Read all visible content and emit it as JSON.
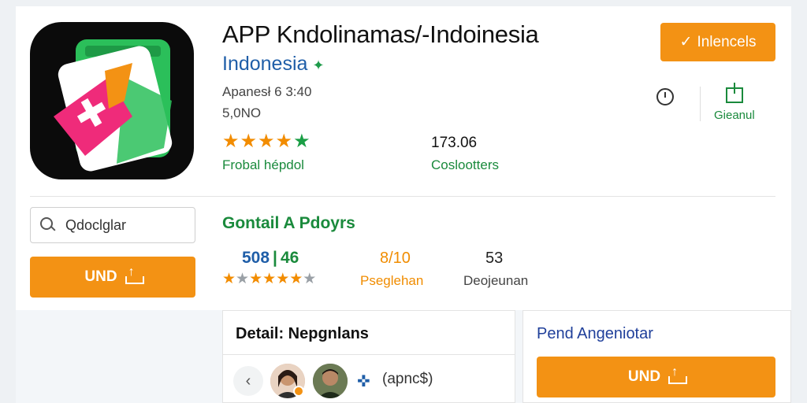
{
  "header": {
    "title": "APP Kndolinamas/-Indoinesia",
    "subtitle": "Indonesia",
    "meta_line1": "Apanesł 6 3:40",
    "meta_line2": "5,0NO",
    "install_button_label": "Inlencels",
    "install_button_icon": "check-icon",
    "gift_label": "Gieanul"
  },
  "ratings": {
    "stars": 5,
    "rating_label": "Frobal hépdol",
    "downloads_value": "173.06",
    "downloads_label": "Coslootters"
  },
  "sidebar": {
    "search_value": "Qdoclglar",
    "install_label": "UND"
  },
  "stats": {
    "section_title": "Gontail A Pdoyrs",
    "stat1_value_a": "508",
    "stat1_separator": "|",
    "stat1_value_b": "46",
    "stat1_stars": 5,
    "stat2_value": "8/10",
    "stat2_label": "Pseglehan",
    "stat3_value": "53",
    "stat3_label": "Deojeunan"
  },
  "details": {
    "title": "Detail: Nepgnlans",
    "share_label": "(apnc$)"
  },
  "side_panel": {
    "title": "Pend Angeniotar",
    "install_label": "UND"
  },
  "colors": {
    "accent_orange": "#f39214",
    "green": "#1a8a3c",
    "blue": "#1f5ea8"
  }
}
